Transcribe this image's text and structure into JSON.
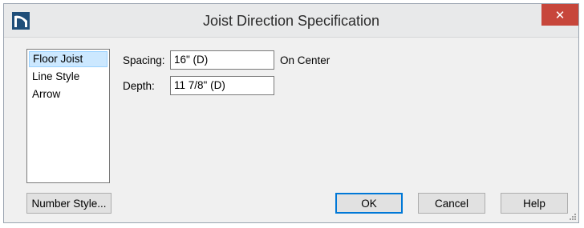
{
  "window": {
    "title": "Joist Direction Specification",
    "close_symbol": "✕",
    "app_icon": "chief-architect-icon"
  },
  "sidebar": {
    "items": [
      {
        "label": "Floor Joist",
        "selected": true
      },
      {
        "label": "Line Style",
        "selected": false
      },
      {
        "label": "Arrow",
        "selected": false
      }
    ]
  },
  "form": {
    "spacing": {
      "label": "Spacing:",
      "value": "16\" (D)",
      "suffix": "On Center"
    },
    "depth": {
      "label": "Depth:",
      "value": "11 7/8\" (D)"
    }
  },
  "buttons": {
    "number_style": "Number Style...",
    "ok": "OK",
    "cancel": "Cancel",
    "help": "Help"
  },
  "colors": {
    "close_button": "#c7463b",
    "selection": "#cce8ff",
    "default_button_border": "#0078d7"
  }
}
